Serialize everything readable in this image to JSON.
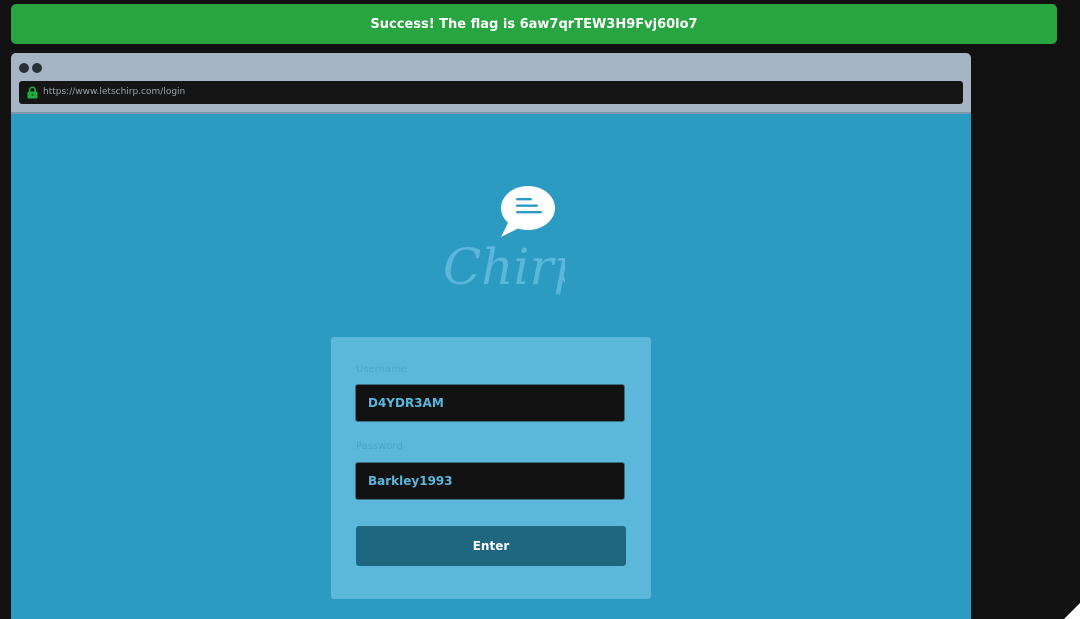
{
  "banner": {
    "message": "Success! The flag is 6aw7qrTEW3H9Fvj60lo7"
  },
  "browser": {
    "url": "https://www.letschirp.com/login"
  },
  "logo": {
    "text": "Chirp"
  },
  "login_form": {
    "username_label": "Username",
    "username_value": "D4YDR3AM",
    "password_label": "Password",
    "password_value": "Barkley1993",
    "submit_label": "Enter"
  },
  "colors": {
    "banner_bg": "#28a440",
    "page_bg": "#2b9bc2",
    "card_bg": "#5bb8db",
    "button_bg": "#1f6680",
    "input_bg": "#121212",
    "input_text": "#5cb6dc"
  },
  "icons": {
    "lock": "lock-icon",
    "speech_bubble": "speech-bubble-icon"
  }
}
